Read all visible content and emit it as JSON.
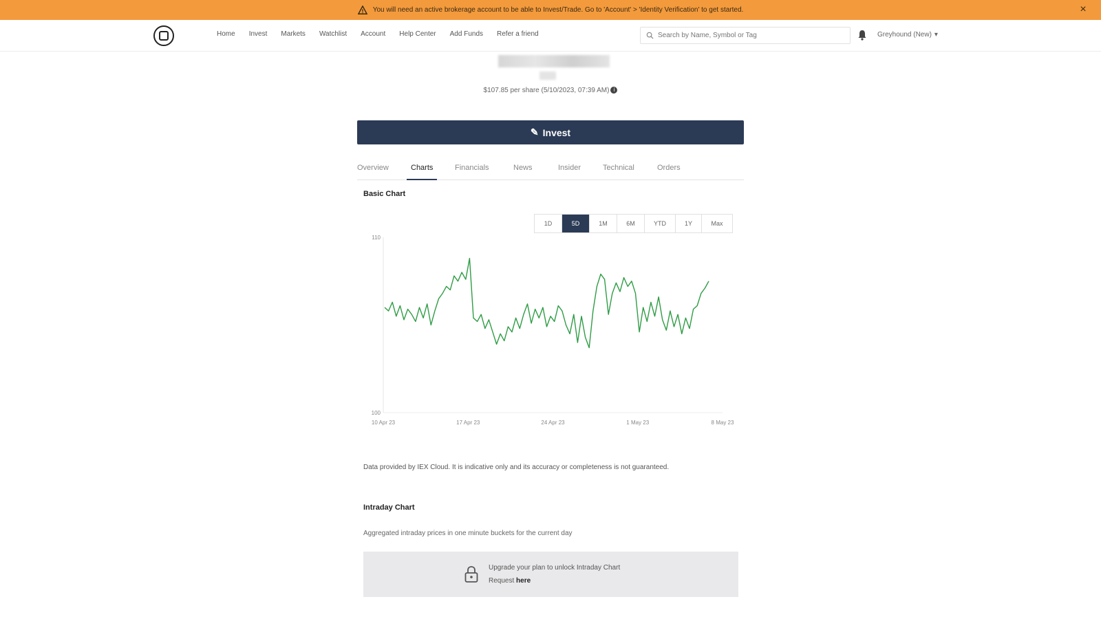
{
  "banner": {
    "text": "You will need an active brokerage account to be able to Invest/Trade. Go to 'Account' > 'Identity Verification' to get started.",
    "color": "#f39a3c"
  },
  "nav": {
    "links": [
      "Home",
      "Invest",
      "Markets",
      "Watchlist",
      "Account",
      "Help Center",
      "Add Funds",
      "Refer a friend"
    ],
    "search_placeholder": "Search by Name, Symbol or Tag",
    "user_name": "Greyhound (New)"
  },
  "stock": {
    "price_line": "$107.85 per share (5/10/2023, 07:39 AM)"
  },
  "invest_button": {
    "label": "Invest",
    "color": "#2b3a55"
  },
  "tabs": [
    "Overview",
    "Charts",
    "Financials",
    "News",
    "Insider",
    "Technical",
    "Orders"
  ],
  "active_tab": "Charts",
  "basic_chart": {
    "title": "Basic Chart",
    "ranges": [
      "1D",
      "5D",
      "1M",
      "6M",
      "YTD",
      "1Y",
      "Max"
    ],
    "active_range": "5D"
  },
  "chart_data": {
    "type": "line",
    "title": "",
    "xlabel": "",
    "ylabel": "",
    "ylim": [
      100,
      110
    ],
    "yticks": [
      "110",
      "100"
    ],
    "xticks": [
      "10 Apr 23",
      "17 Apr 23",
      "24 Apr 23",
      "1 May 23",
      "8 May 23"
    ],
    "grid": false,
    "color": "#2e9c44",
    "series": [
      {
        "values": [
          106.0,
          105.8,
          106.3,
          105.5,
          106.1,
          105.3,
          105.9,
          105.6,
          105.2,
          106.0,
          105.4,
          106.2,
          105.0,
          105.8,
          106.5,
          106.8,
          107.2,
          107.0,
          107.8,
          107.5,
          108.0,
          107.6,
          108.8,
          105.4,
          105.2,
          105.6,
          104.8,
          105.3,
          104.6,
          103.9,
          104.5,
          104.1,
          104.9,
          104.6,
          105.4,
          104.8,
          105.6,
          106.2,
          105.1,
          105.9,
          105.4,
          106.0,
          104.9,
          105.5,
          105.2,
          106.1,
          105.8,
          105.0,
          104.5,
          105.6,
          104.0,
          105.5,
          104.3,
          103.7,
          105.8,
          107.2,
          107.9,
          107.6,
          105.6,
          106.8,
          107.4,
          106.9,
          107.7,
          107.2,
          107.5,
          106.8,
          104.6,
          106.0,
          105.2,
          106.3,
          105.5,
          106.6,
          105.3,
          104.7,
          105.8,
          104.9,
          105.6,
          104.5,
          105.4,
          104.8,
          105.9,
          106.1,
          106.8,
          107.1,
          107.5
        ]
      }
    ]
  },
  "disclaimer": "Data provided by IEX Cloud. It is indicative only and its accuracy or completeness is not guaranteed.",
  "intraday": {
    "title": "Intraday Chart",
    "description": "Aggregated intraday prices in one minute buckets for the current day",
    "upgrade_text": "Upgrade your plan to unlock Intraday Chart",
    "request_prefix": "Request",
    "request_link": "here"
  }
}
